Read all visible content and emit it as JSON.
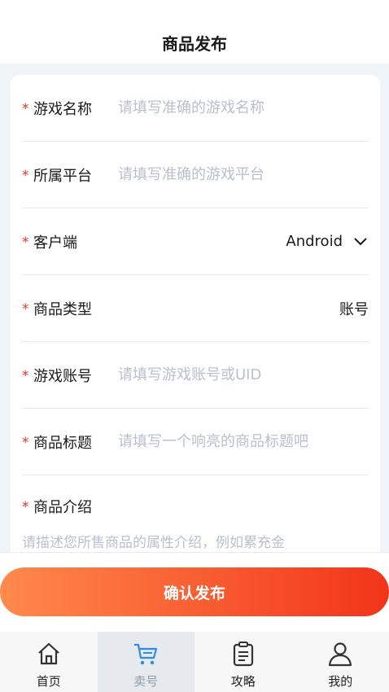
{
  "header": {
    "title": "商品发布"
  },
  "form": {
    "game_name": {
      "label": "游戏名称",
      "placeholder": "请填写准确的游戏名称"
    },
    "platform": {
      "label": "所属平台",
      "placeholder": "请填写准确的游戏平台"
    },
    "client": {
      "label": "客户端",
      "value": "Android"
    },
    "product_type": {
      "label": "商品类型",
      "value": "账号"
    },
    "game_account": {
      "label": "游戏账号",
      "placeholder": "请填写游戏账号或UID"
    },
    "product_title": {
      "label": "商品标题",
      "placeholder": "请填写一个响亮的商品标题吧"
    },
    "product_intro": {
      "label": "商品介绍",
      "placeholder": "请描述您所售商品的属性介绍，例如累充金"
    },
    "required_mark": "*"
  },
  "actions": {
    "confirm_label": "确认发布"
  },
  "tabbar": {
    "items": [
      {
        "label": "首页",
        "icon": "home-icon"
      },
      {
        "label": "卖号",
        "icon": "cart-icon",
        "active": true
      },
      {
        "label": "攻略",
        "icon": "clipboard-icon"
      },
      {
        "label": "我的",
        "icon": "user-icon"
      }
    ]
  },
  "colors": {
    "accent_start": "#ff8a4c",
    "accent_end": "#f2341a",
    "required": "#e8352b",
    "placeholder": "#b9bfcc"
  }
}
